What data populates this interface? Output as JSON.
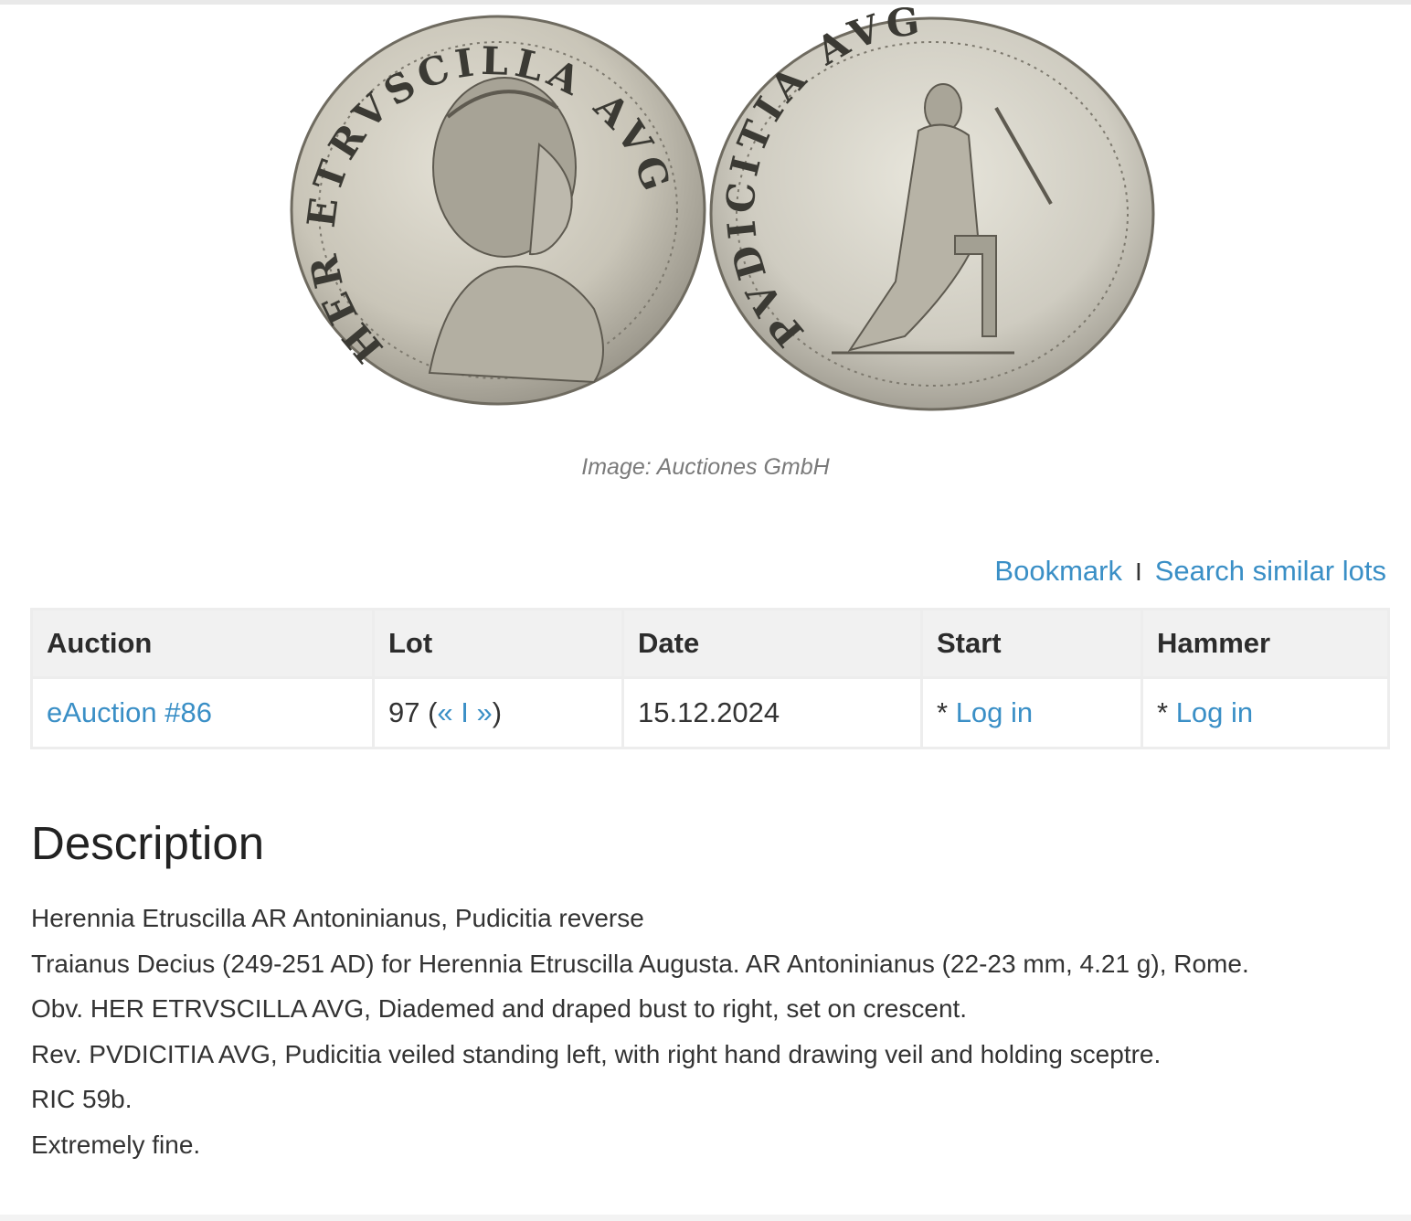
{
  "image": {
    "caption": "Image: Auctiones GmbH",
    "obverse_legend": "HER ETRVSCILLA AVG",
    "reverse_legend": "PVDICITIA AVG"
  },
  "actions": {
    "bookmark": "Bookmark",
    "separator": "I",
    "search_similar": "Search similar lots"
  },
  "table": {
    "headers": {
      "auction": "Auction",
      "lot": "Lot",
      "date": "Date",
      "start": "Start",
      "hammer": "Hammer"
    },
    "row": {
      "auction": "eAuction #86",
      "lot_number": "97 (",
      "prev": "«",
      "lot_sep": "I",
      "next": "»",
      "lot_close": ")",
      "date": "15.12.2024",
      "start_prefix": "* ",
      "start_link": "Log in",
      "hammer_prefix": "* ",
      "hammer_link": "Log in"
    }
  },
  "description": {
    "title": "Description",
    "lines": [
      "Herennia Etruscilla AR Antoninianus, Pudicitia reverse",
      "Traianus Decius (249-251 AD) for Herennia Etruscilla Augusta. AR Antoninianus (22-23 mm, 4.21 g), Rome.",
      "Obv. HER ETRVSCILLA AVG, Diademed and draped bust to right, set on crescent.",
      "Rev. PVDICITIA AVG, Pudicitia veiled standing left, with right hand drawing veil and holding sceptre.",
      "RIC 59b.",
      "Extremely fine."
    ]
  },
  "colors": {
    "link": "#3a8fc6",
    "header_bg": "#f1f1f1",
    "border": "#ededed",
    "caption": "#7a7a7a"
  }
}
